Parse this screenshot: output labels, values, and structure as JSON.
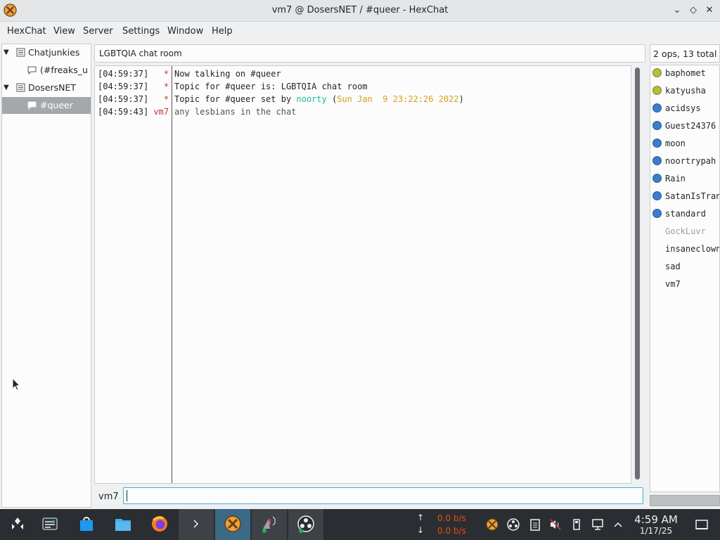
{
  "window": {
    "title": "vm7 @ DosersNET / #queer - HexChat"
  },
  "menu": [
    "HexChat",
    "View",
    "Server",
    "Settings",
    "Window",
    "Help"
  ],
  "tree": [
    {
      "label": "Chatjunkies",
      "type": "server",
      "expanded": true
    },
    {
      "label": "(#freaks_u",
      "type": "channel"
    },
    {
      "label": "DosersNET",
      "type": "server",
      "expanded": true
    },
    {
      "label": "#queer",
      "type": "channel",
      "selected": true
    }
  ],
  "topic": "LGBTQIA chat room",
  "chat_lines": [
    {
      "ts": "[04:59:37]",
      "nick": "*",
      "nick_color": "#c0392b",
      "parts": [
        {
          "t": "Now talking on #queer",
          "c": "#232627"
        }
      ]
    },
    {
      "ts": "[04:59:37]",
      "nick": "*",
      "nick_color": "#c0392b",
      "parts": [
        {
          "t": "Topic for #queer is: LGBTQIA chat room",
          "c": "#232627"
        }
      ]
    },
    {
      "ts": "[04:59:37]",
      "nick": "*",
      "nick_color": "#c0392b",
      "parts": [
        {
          "t": "Topic for #queer set by ",
          "c": "#232627"
        },
        {
          "t": "noorty",
          "c": "#1abc9c"
        },
        {
          "t": " (",
          "c": "#232627"
        },
        {
          "t": "Sun Jan  9 23:22:26 2022",
          "c": "#d4a017"
        },
        {
          "t": ")",
          "c": "#232627"
        }
      ]
    },
    {
      "ts": "[04:59:43]",
      "nick": "vm7",
      "nick_color": "#c0392b",
      "parts": [
        {
          "t": "any lesbians in the chat",
          "c": "#555555"
        }
      ]
    }
  ],
  "users_header": "2 ops, 13 total",
  "users": [
    {
      "name": "baphomet",
      "status": "op",
      "color": "#b5bd3a"
    },
    {
      "name": "katyusha",
      "status": "op",
      "color": "#b5bd3a"
    },
    {
      "name": "acidsys",
      "status": "voice",
      "color": "#3d7cc9"
    },
    {
      "name": "Guest24376",
      "status": "voice",
      "color": "#3d7cc9"
    },
    {
      "name": "moon",
      "status": "voice",
      "color": "#3d7cc9"
    },
    {
      "name": "noortrypah",
      "status": "voice",
      "color": "#3d7cc9"
    },
    {
      "name": "Rain",
      "status": "voice",
      "color": "#3d7cc9"
    },
    {
      "name": "SatanIsTran",
      "status": "voice",
      "color": "#3d7cc9"
    },
    {
      "name": "standard",
      "status": "voice",
      "color": "#3d7cc9"
    },
    {
      "name": "GockLuvr",
      "status": "away",
      "color": ""
    },
    {
      "name": "insaneclown",
      "status": "none",
      "color": ""
    },
    {
      "name": "sad",
      "status": "none",
      "color": ""
    },
    {
      "name": "vm7",
      "status": "none",
      "color": ""
    }
  ],
  "input": {
    "nick": "vm7",
    "value": ""
  },
  "taskbar": {
    "net_up": "0.0 b/s",
    "net_down": "0.0 b/s",
    "time": "4:59 AM",
    "date": "1/17/25"
  }
}
